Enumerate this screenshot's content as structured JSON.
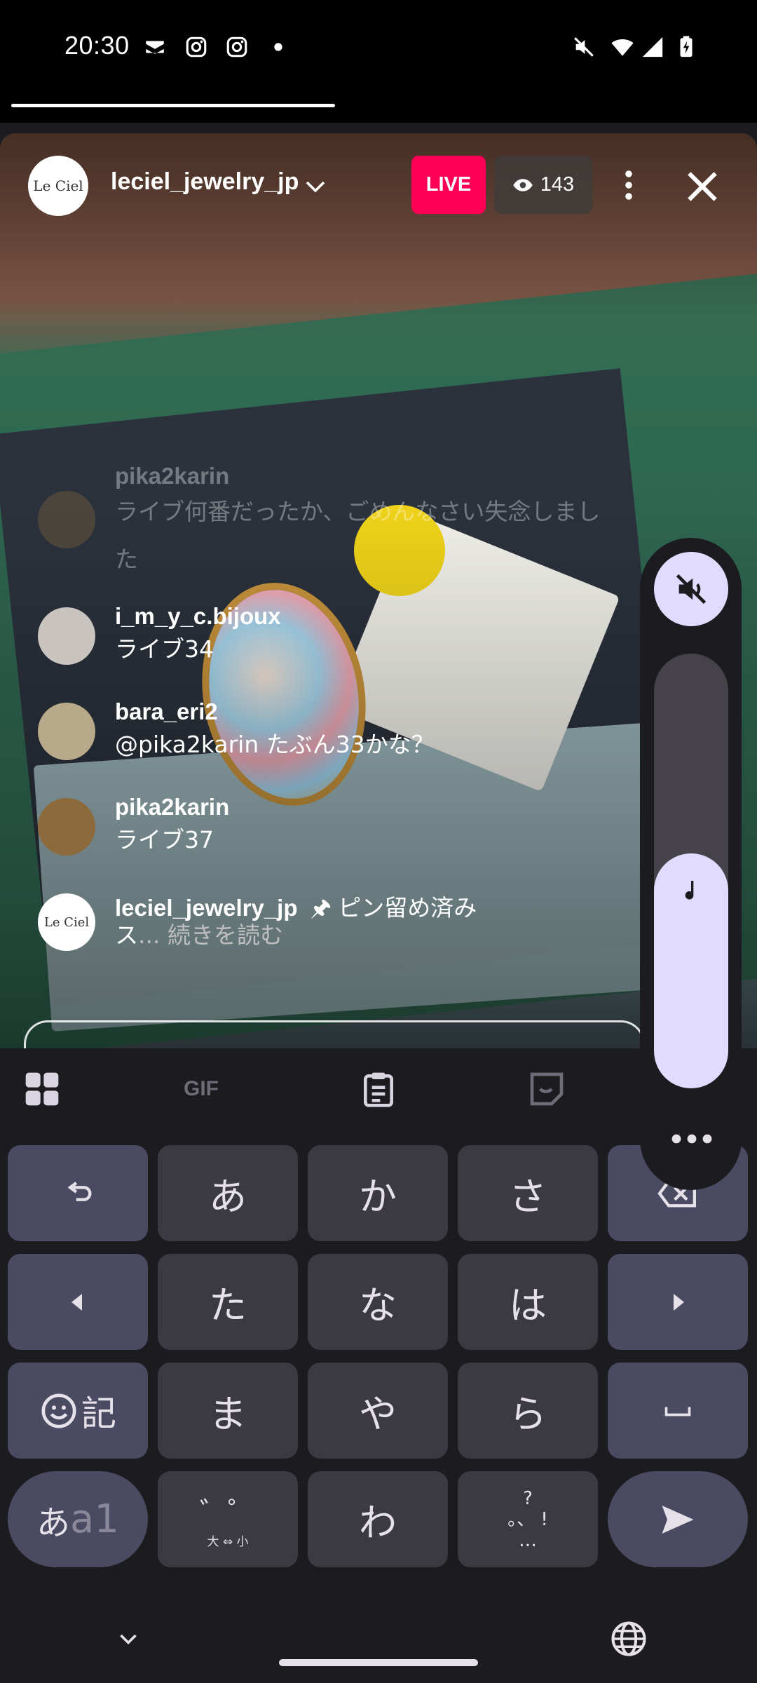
{
  "status_bar": {
    "time": "20:30",
    "icons": [
      "capcut-icon",
      "instagram-icon",
      "instagram-icon",
      "dot-icon",
      "mute-icon",
      "wifi-icon",
      "signal-icon",
      "battery-charging-icon"
    ]
  },
  "live_header": {
    "account": "leciel_jewelry_jp",
    "avatar_text": "Le Ciel",
    "live_label": "LIVE",
    "viewer_count": "143"
  },
  "comments": [
    {
      "user": "pika2karin",
      "text": "ライブ何番だったか、ごめんなさい失念しました",
      "faded": true
    },
    {
      "user": "i_m_y_c.bijoux",
      "text": "ライブ34"
    },
    {
      "user": "bara_eri2",
      "text": "@pika2karin たぶん33かな？"
    },
    {
      "user": "pika2karin",
      "text": "ライブ37"
    },
    {
      "user": "leciel_jewelry_jp",
      "pin_label": "ピン留め済み",
      "text": "ス",
      "more_label": "... 続きを読む"
    }
  ],
  "keyboard": {
    "toolbar": [
      "apps-icon",
      "GIF",
      "clipboard-icon",
      "sticker-icon"
    ],
    "rows": [
      [
        "undo",
        "あ",
        "か",
        "さ",
        "backspace"
      ],
      [
        "left",
        "た",
        "な",
        "は",
        "right"
      ],
      [
        "emoji-記",
        "ま",
        "や",
        "ら",
        "space"
      ],
      [
        "あa1",
        "゛゜大⇔小",
        "わ",
        "、。?!",
        "send"
      ]
    ],
    "emoji_key_label": "記",
    "mode_key_label_kana": "あ",
    "mode_key_label_alnum": "a1",
    "dakuten_label": "゛゜",
    "size_toggle_label": "大 ⇔ 小",
    "punct_label_top": "?",
    "punct_label_mid": "。、 !",
    "punct_label_bottom": "…"
  },
  "volume_panel": {
    "level": 0.54,
    "muted": true
  },
  "colors": {
    "live_red": "#fe0055",
    "keyboard_bg": "#1c1b20",
    "key_bg": "#3b3a42",
    "key_fn_bg": "#4a4a62",
    "volume_accent": "#e1dcff"
  }
}
